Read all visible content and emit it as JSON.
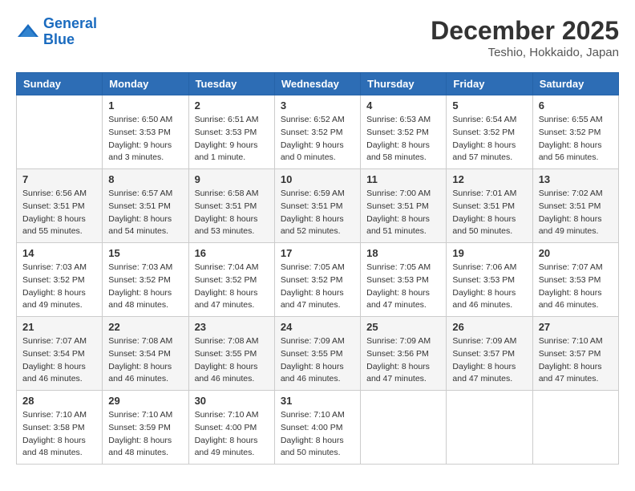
{
  "logo": {
    "text_general": "General",
    "text_blue": "Blue"
  },
  "header": {
    "month": "December 2025",
    "location": "Teshio, Hokkaido, Japan"
  },
  "weekdays": [
    "Sunday",
    "Monday",
    "Tuesday",
    "Wednesday",
    "Thursday",
    "Friday",
    "Saturday"
  ],
  "weeks": [
    [
      {
        "day": "",
        "sunrise": "",
        "sunset": "",
        "daylight": ""
      },
      {
        "day": "1",
        "sunrise": "Sunrise: 6:50 AM",
        "sunset": "Sunset: 3:53 PM",
        "daylight": "Daylight: 9 hours and 3 minutes."
      },
      {
        "day": "2",
        "sunrise": "Sunrise: 6:51 AM",
        "sunset": "Sunset: 3:53 PM",
        "daylight": "Daylight: 9 hours and 1 minute."
      },
      {
        "day": "3",
        "sunrise": "Sunrise: 6:52 AM",
        "sunset": "Sunset: 3:52 PM",
        "daylight": "Daylight: 9 hours and 0 minutes."
      },
      {
        "day": "4",
        "sunrise": "Sunrise: 6:53 AM",
        "sunset": "Sunset: 3:52 PM",
        "daylight": "Daylight: 8 hours and 58 minutes."
      },
      {
        "day": "5",
        "sunrise": "Sunrise: 6:54 AM",
        "sunset": "Sunset: 3:52 PM",
        "daylight": "Daylight: 8 hours and 57 minutes."
      },
      {
        "day": "6",
        "sunrise": "Sunrise: 6:55 AM",
        "sunset": "Sunset: 3:52 PM",
        "daylight": "Daylight: 8 hours and 56 minutes."
      }
    ],
    [
      {
        "day": "7",
        "sunrise": "Sunrise: 6:56 AM",
        "sunset": "Sunset: 3:51 PM",
        "daylight": "Daylight: 8 hours and 55 minutes."
      },
      {
        "day": "8",
        "sunrise": "Sunrise: 6:57 AM",
        "sunset": "Sunset: 3:51 PM",
        "daylight": "Daylight: 8 hours and 54 minutes."
      },
      {
        "day": "9",
        "sunrise": "Sunrise: 6:58 AM",
        "sunset": "Sunset: 3:51 PM",
        "daylight": "Daylight: 8 hours and 53 minutes."
      },
      {
        "day": "10",
        "sunrise": "Sunrise: 6:59 AM",
        "sunset": "Sunset: 3:51 PM",
        "daylight": "Daylight: 8 hours and 52 minutes."
      },
      {
        "day": "11",
        "sunrise": "Sunrise: 7:00 AM",
        "sunset": "Sunset: 3:51 PM",
        "daylight": "Daylight: 8 hours and 51 minutes."
      },
      {
        "day": "12",
        "sunrise": "Sunrise: 7:01 AM",
        "sunset": "Sunset: 3:51 PM",
        "daylight": "Daylight: 8 hours and 50 minutes."
      },
      {
        "day": "13",
        "sunrise": "Sunrise: 7:02 AM",
        "sunset": "Sunset: 3:51 PM",
        "daylight": "Daylight: 8 hours and 49 minutes."
      }
    ],
    [
      {
        "day": "14",
        "sunrise": "Sunrise: 7:03 AM",
        "sunset": "Sunset: 3:52 PM",
        "daylight": "Daylight: 8 hours and 49 minutes."
      },
      {
        "day": "15",
        "sunrise": "Sunrise: 7:03 AM",
        "sunset": "Sunset: 3:52 PM",
        "daylight": "Daylight: 8 hours and 48 minutes."
      },
      {
        "day": "16",
        "sunrise": "Sunrise: 7:04 AM",
        "sunset": "Sunset: 3:52 PM",
        "daylight": "Daylight: 8 hours and 47 minutes."
      },
      {
        "day": "17",
        "sunrise": "Sunrise: 7:05 AM",
        "sunset": "Sunset: 3:52 PM",
        "daylight": "Daylight: 8 hours and 47 minutes."
      },
      {
        "day": "18",
        "sunrise": "Sunrise: 7:05 AM",
        "sunset": "Sunset: 3:53 PM",
        "daylight": "Daylight: 8 hours and 47 minutes."
      },
      {
        "day": "19",
        "sunrise": "Sunrise: 7:06 AM",
        "sunset": "Sunset: 3:53 PM",
        "daylight": "Daylight: 8 hours and 46 minutes."
      },
      {
        "day": "20",
        "sunrise": "Sunrise: 7:07 AM",
        "sunset": "Sunset: 3:53 PM",
        "daylight": "Daylight: 8 hours and 46 minutes."
      }
    ],
    [
      {
        "day": "21",
        "sunrise": "Sunrise: 7:07 AM",
        "sunset": "Sunset: 3:54 PM",
        "daylight": "Daylight: 8 hours and 46 minutes."
      },
      {
        "day": "22",
        "sunrise": "Sunrise: 7:08 AM",
        "sunset": "Sunset: 3:54 PM",
        "daylight": "Daylight: 8 hours and 46 minutes."
      },
      {
        "day": "23",
        "sunrise": "Sunrise: 7:08 AM",
        "sunset": "Sunset: 3:55 PM",
        "daylight": "Daylight: 8 hours and 46 minutes."
      },
      {
        "day": "24",
        "sunrise": "Sunrise: 7:09 AM",
        "sunset": "Sunset: 3:55 PM",
        "daylight": "Daylight: 8 hours and 46 minutes."
      },
      {
        "day": "25",
        "sunrise": "Sunrise: 7:09 AM",
        "sunset": "Sunset: 3:56 PM",
        "daylight": "Daylight: 8 hours and 47 minutes."
      },
      {
        "day": "26",
        "sunrise": "Sunrise: 7:09 AM",
        "sunset": "Sunset: 3:57 PM",
        "daylight": "Daylight: 8 hours and 47 minutes."
      },
      {
        "day": "27",
        "sunrise": "Sunrise: 7:10 AM",
        "sunset": "Sunset: 3:57 PM",
        "daylight": "Daylight: 8 hours and 47 minutes."
      }
    ],
    [
      {
        "day": "28",
        "sunrise": "Sunrise: 7:10 AM",
        "sunset": "Sunset: 3:58 PM",
        "daylight": "Daylight: 8 hours and 48 minutes."
      },
      {
        "day": "29",
        "sunrise": "Sunrise: 7:10 AM",
        "sunset": "Sunset: 3:59 PM",
        "daylight": "Daylight: 8 hours and 48 minutes."
      },
      {
        "day": "30",
        "sunrise": "Sunrise: 7:10 AM",
        "sunset": "Sunset: 4:00 PM",
        "daylight": "Daylight: 8 hours and 49 minutes."
      },
      {
        "day": "31",
        "sunrise": "Sunrise: 7:10 AM",
        "sunset": "Sunset: 4:00 PM",
        "daylight": "Daylight: 8 hours and 50 minutes."
      },
      {
        "day": "",
        "sunrise": "",
        "sunset": "",
        "daylight": ""
      },
      {
        "day": "",
        "sunrise": "",
        "sunset": "",
        "daylight": ""
      },
      {
        "day": "",
        "sunrise": "",
        "sunset": "",
        "daylight": ""
      }
    ]
  ]
}
